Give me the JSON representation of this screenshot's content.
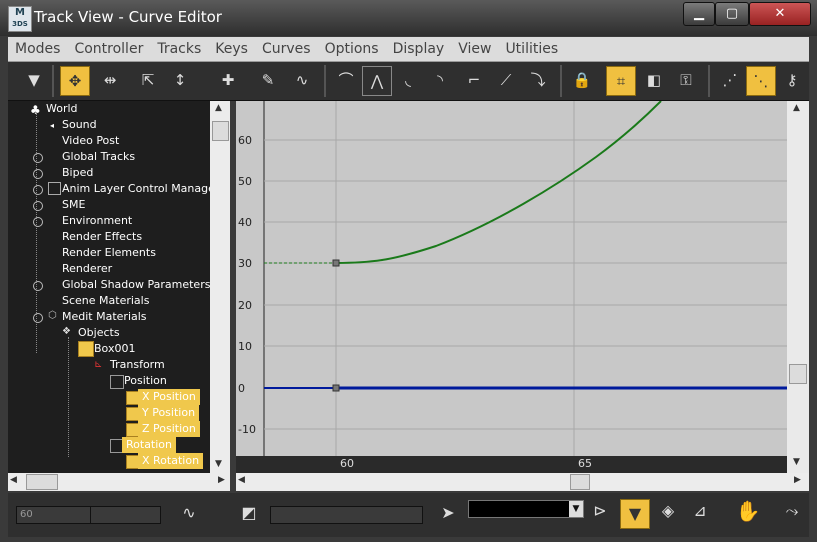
{
  "window": {
    "title": "Track View - Curve Editor",
    "app_logo_text": "3DS",
    "controls": {
      "minimize": "▁",
      "maximize": "▢",
      "close": "✕"
    }
  },
  "menu": [
    "Modes",
    "Controller",
    "Tracks",
    "Keys",
    "Curves",
    "Options",
    "Display",
    "View",
    "Utilities"
  ],
  "toolbar": {
    "icons": [
      "filter-icon",
      "move-keys-icon",
      "slide-keys-icon",
      "scale-keys-icon",
      "scale-values-icon",
      "add-keys-icon",
      "draw-curves-icon",
      "reduce-keys-icon",
      "set-tangents-auto-icon",
      "set-tangents-custom-icon",
      "set-tangents-fast-icon",
      "set-tangents-slow-icon",
      "set-tangents-step-icon",
      "set-tangents-linear-icon",
      "set-tangents-smooth-icon",
      "lock-selection-icon",
      "snap-frames-icon",
      "parameter-out-of-range-icon",
      "show-keyable-icons-icon",
      "show-all-tangents-icon",
      "show-tangents-icon",
      "lock-tangents-icon"
    ],
    "active": [
      "move-keys-icon",
      "snap-frames-icon",
      "show-tangents-icon"
    ]
  },
  "tree": {
    "items": [
      {
        "label": "World"
      },
      {
        "label": "Sound"
      },
      {
        "label": "Video Post"
      },
      {
        "label": "Global Tracks"
      },
      {
        "label": "Biped"
      },
      {
        "label": "Anim Layer Control Manager"
      },
      {
        "label": "SME"
      },
      {
        "label": "Environment"
      },
      {
        "label": "Render Effects"
      },
      {
        "label": "Render Elements"
      },
      {
        "label": "Renderer"
      },
      {
        "label": "Global Shadow Parameters"
      },
      {
        "label": "Scene Materials"
      },
      {
        "label": "Medit Materials"
      },
      {
        "label": "Objects"
      },
      {
        "label": "Box001"
      },
      {
        "label": "Transform"
      },
      {
        "label": "Position"
      },
      {
        "label": "X Position"
      },
      {
        "label": "Y Position"
      },
      {
        "label": "Z Position"
      },
      {
        "label": "Rotation"
      },
      {
        "label": "X Rotation"
      }
    ]
  },
  "graph": {
    "y_labels": [
      "60",
      "50",
      "40",
      "30",
      "20",
      "10",
      "0",
      "-10"
    ],
    "x_labels": [
      "60",
      "65"
    ],
    "curves": [
      {
        "name": "green-curve",
        "color": "#1a7a1a"
      },
      {
        "name": "blue-curve",
        "color": "#001a9c"
      }
    ]
  },
  "status": {
    "frame_field": "60",
    "value_field": "",
    "icons": [
      "key-stats-icon",
      "zoom-region-icon",
      "select-cursor-icon",
      "filter-selected-icon",
      "isolate-curve-icon",
      "pan-icon",
      "zoom-icon"
    ]
  }
}
